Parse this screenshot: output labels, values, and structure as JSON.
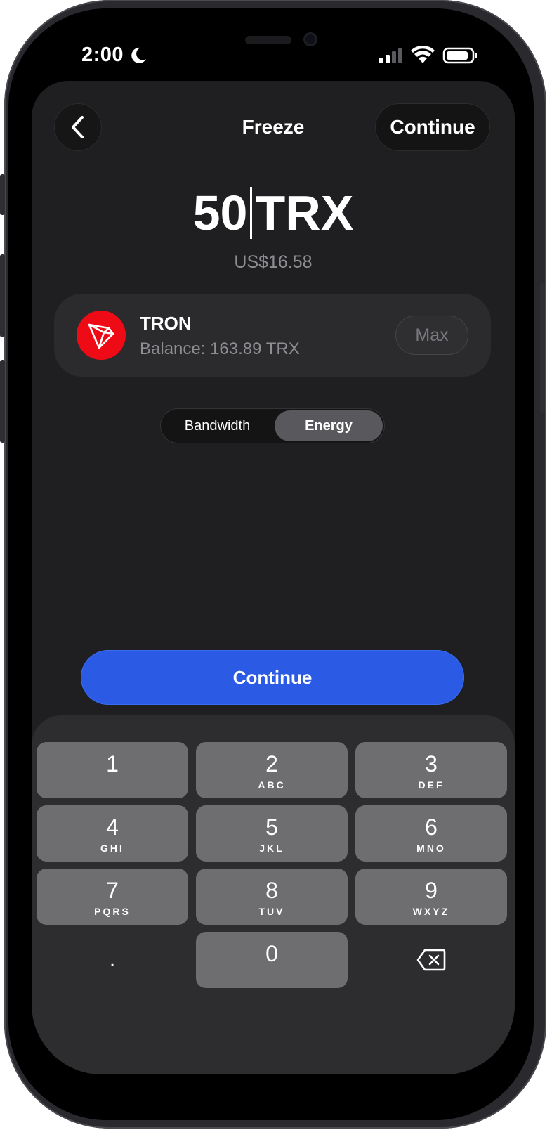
{
  "status_bar": {
    "time": "2:00"
  },
  "header": {
    "title": "Freeze",
    "continue_label": "Continue"
  },
  "amount": {
    "value": "50",
    "unit": "TRX",
    "fiat": "US$16.58"
  },
  "token": {
    "name": "TRON",
    "balance": "Balance: 163.89 TRX",
    "max_label": "Max",
    "logo_color": "#ef0b15"
  },
  "resource_toggle": {
    "options": [
      "Bandwidth",
      "Energy"
    ],
    "selected": "Energy"
  },
  "main_button": {
    "label": "Continue",
    "color": "#2b5be4"
  },
  "keypad": {
    "keys": [
      {
        "digit": "1",
        "letters": ""
      },
      {
        "digit": "2",
        "letters": "ABC"
      },
      {
        "digit": "3",
        "letters": "DEF"
      },
      {
        "digit": "4",
        "letters": "GHI"
      },
      {
        "digit": "5",
        "letters": "JKL"
      },
      {
        "digit": "6",
        "letters": "MNO"
      },
      {
        "digit": "7",
        "letters": "PQRS"
      },
      {
        "digit": "8",
        "letters": "TUV"
      },
      {
        "digit": "9",
        "letters": "WXYZ"
      },
      {
        "digit": "0",
        "letters": ""
      }
    ],
    "decimal": ".",
    "backspace_icon": "backspace-icon"
  }
}
